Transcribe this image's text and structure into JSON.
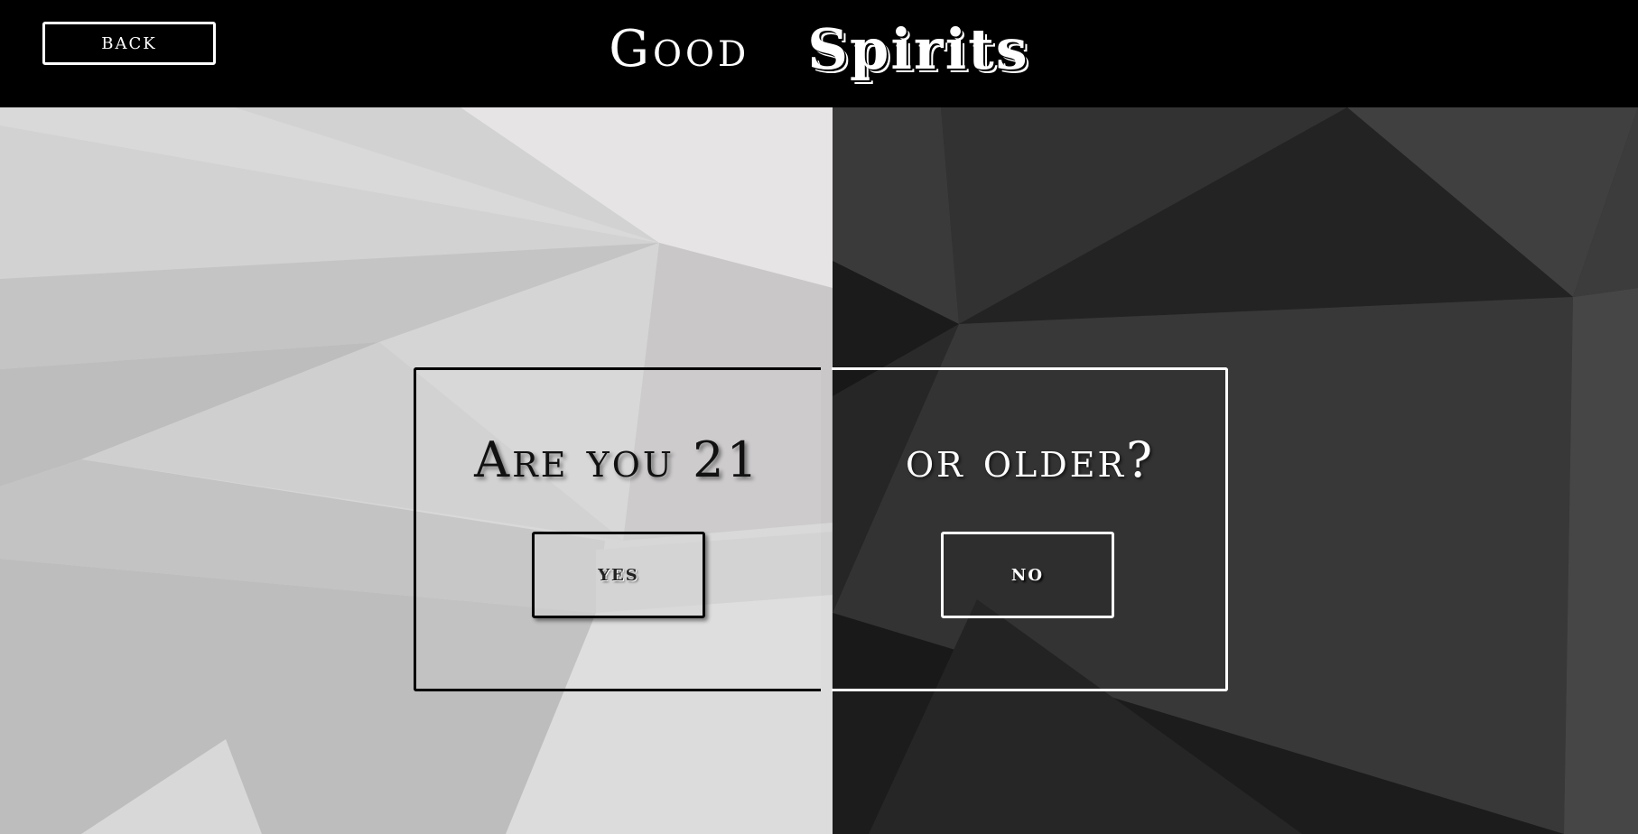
{
  "header": {
    "back_label": "BACK",
    "brand_first": "Good",
    "brand_second": "Spirits"
  },
  "age_gate": {
    "question_left": "Are you 21",
    "question_right": "or older?",
    "yes_label": "YES",
    "no_label": "NO"
  },
  "colors": {
    "header_background": "#000000",
    "light_panel": "#d6d6d6",
    "dark_panel": "#2c2c2c"
  }
}
